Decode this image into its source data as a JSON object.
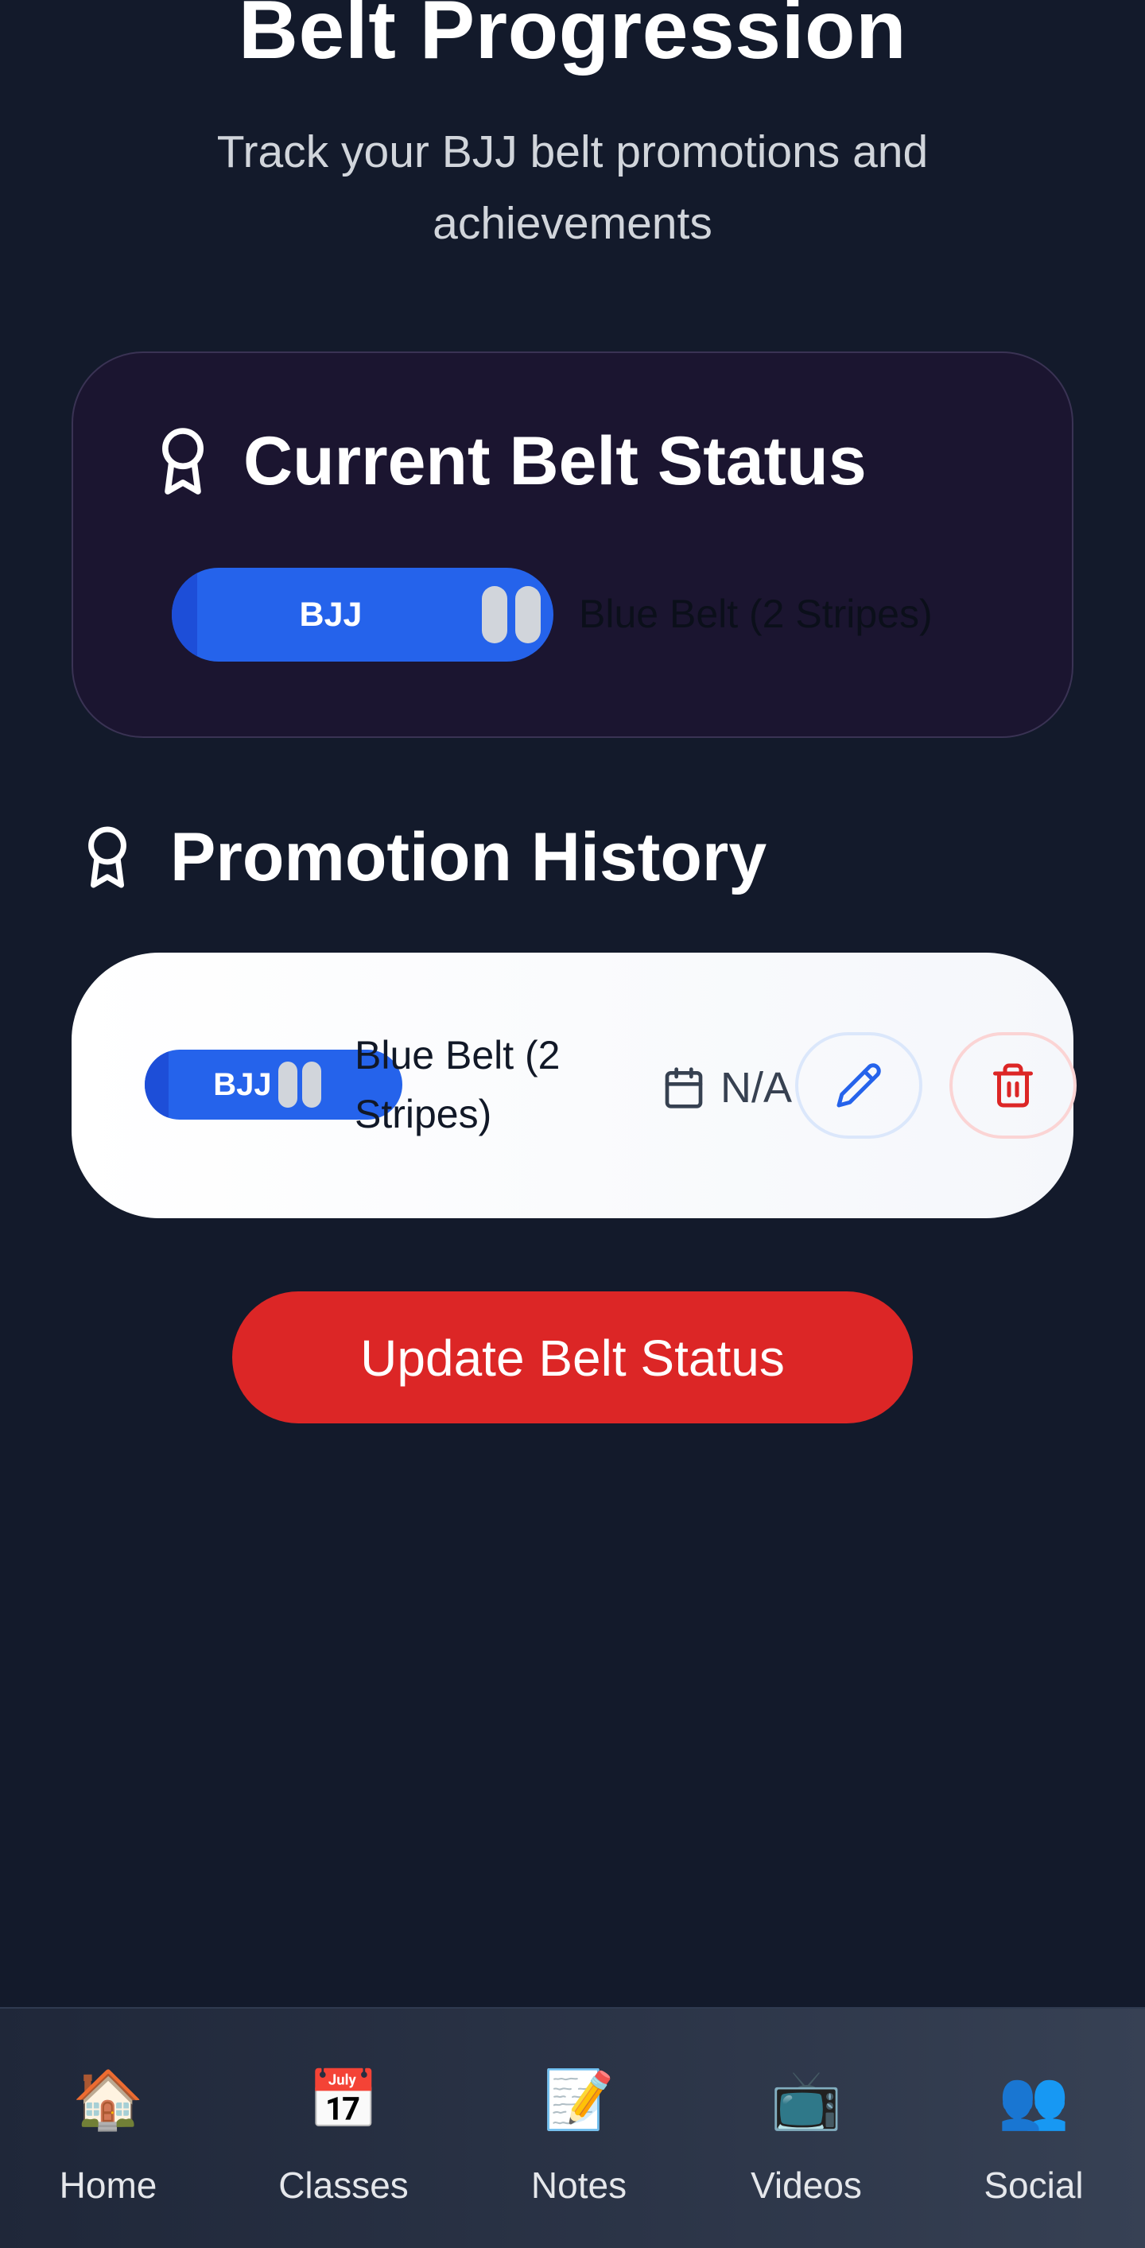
{
  "header": {
    "title": "Belt Progression",
    "subtitle": "Track your BJJ belt promotions and achievements"
  },
  "current_status": {
    "heading": "Current Belt Status",
    "icon": "award-icon",
    "belt_label": "BJJ",
    "belt_color": "#2563eb",
    "stripes": 2,
    "belt_text": "Blue Belt (2 Stripes)"
  },
  "history": {
    "heading": "Promotion History",
    "icon": "award-icon",
    "items": [
      {
        "belt_label": "BJJ",
        "belt_name": "Blue Belt (2 Stripes)",
        "date": "N/A",
        "date_icon": "calendar-icon",
        "edit_icon": "pencil-icon",
        "delete_icon": "trash-icon"
      }
    ]
  },
  "actions": {
    "update_label": "Update Belt Status"
  },
  "nav": {
    "items": [
      {
        "icon": "🏠",
        "label": "Home"
      },
      {
        "icon": "📅",
        "label": "Classes"
      },
      {
        "icon": "📝",
        "label": "Notes"
      },
      {
        "icon": "📺",
        "label": "Videos"
      },
      {
        "icon": "👥",
        "label": "Social"
      }
    ]
  },
  "colors": {
    "background": "#131a2b",
    "belt_blue": "#2563eb",
    "accent_red": "#dc2626",
    "edit_blue": "#2563eb",
    "delete_red": "#dc2626"
  }
}
